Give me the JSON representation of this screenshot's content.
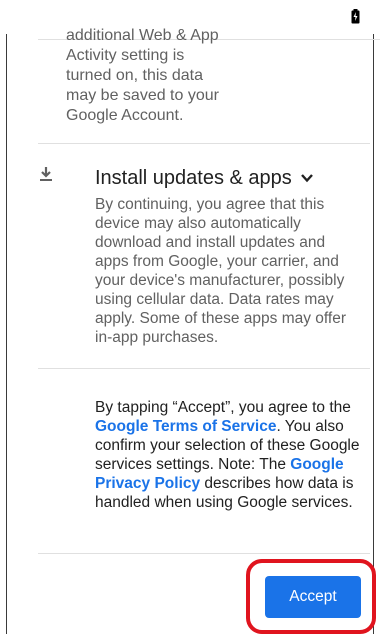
{
  "top_partial_text_lines": [
    "additional Web & App",
    "Activity setting is",
    "turned on, this data",
    "may be saved to your",
    "Google Account."
  ],
  "section": {
    "icon": "download-icon",
    "title": "Install updates & apps",
    "expand_icon": "chevron-down-icon",
    "description": "By continuing, you agree that this device may also automatically download and install updates and apps from Google, your carrier, and your device's manufacturer, possibly using cellular data. Data rates may apply. Some of these apps may offer in-app purchases."
  },
  "legal": {
    "part1": "By tapping “Accept”, you agree to the ",
    "terms_link": "Google Terms of Service",
    "part2": ". You also confirm your selection of these Google services settings. Note: The ",
    "privacy_link": "Google Privacy Policy",
    "part3": " describes how data is handled when using Google services."
  },
  "accept_button": {
    "label": "Accept",
    "color": "#1a73e8",
    "highlight_color": "#e0141e"
  },
  "status_bar": {
    "battery_icon": "battery-charging-icon"
  }
}
